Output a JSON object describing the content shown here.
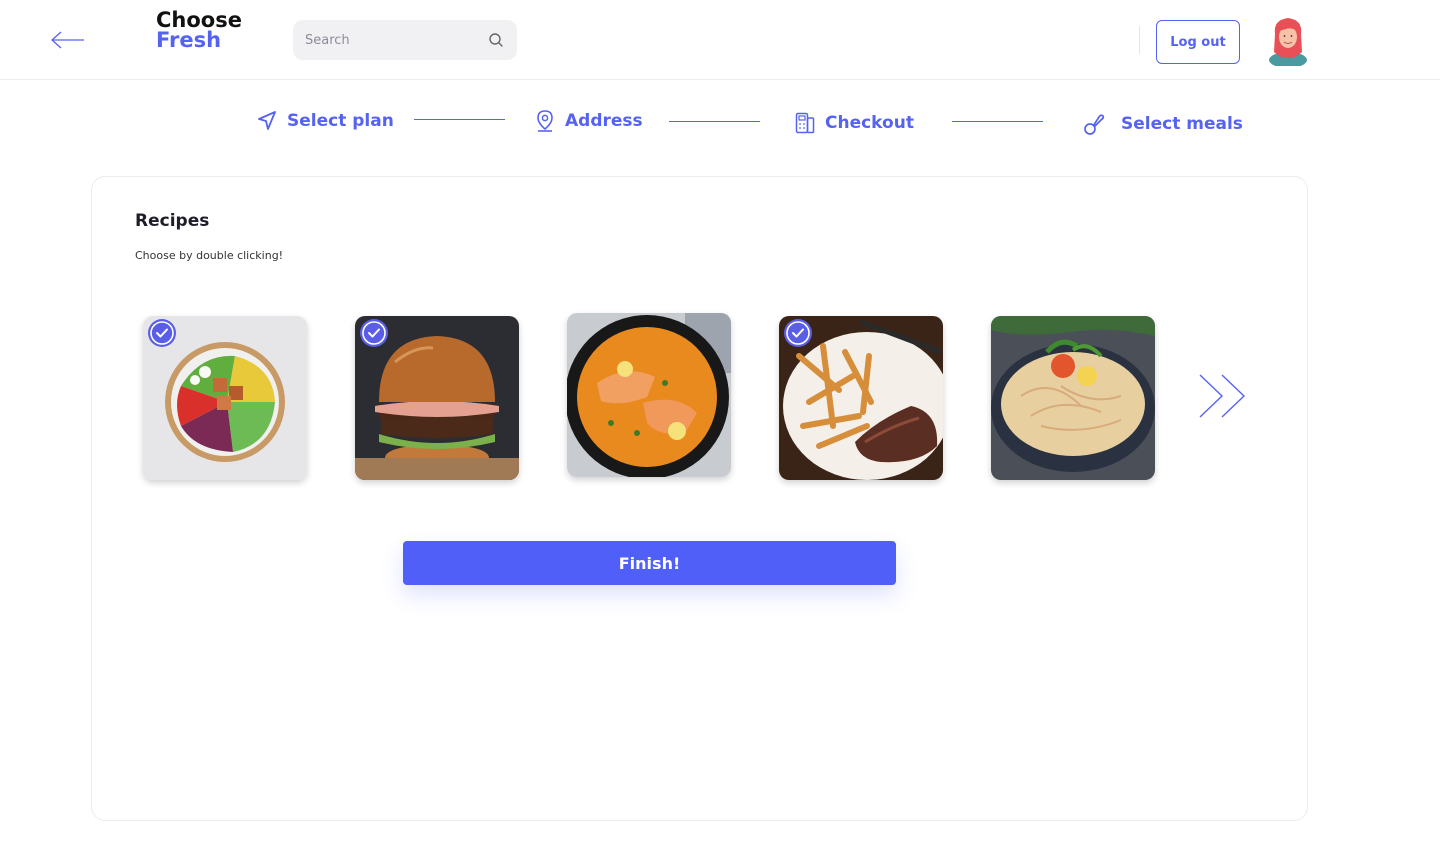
{
  "header": {
    "logo_line1": "Choose",
    "logo_line2": "Fresh",
    "search_placeholder": "Search",
    "logout_label": "Log out"
  },
  "stepper": [
    {
      "label": "Select plan",
      "icon": "navigation-arrow-icon"
    },
    {
      "label": "Address",
      "icon": "map-pin-icon"
    },
    {
      "label": "Checkout",
      "icon": "calculator-icon"
    },
    {
      "label": "Select meals",
      "icon": "meal-icon"
    }
  ],
  "recipes_section": {
    "title": "Recipes",
    "subtitle": "Choose by double clicking!",
    "items": [
      {
        "name": "salad bowl",
        "selected": true
      },
      {
        "name": "burger",
        "selected": true
      },
      {
        "name": "salmon curry",
        "selected": false
      },
      {
        "name": "steak and fries",
        "selected": true
      },
      {
        "name": "noodle soup",
        "selected": false
      }
    ],
    "finish_label": "Finish!"
  },
  "colors": {
    "accent": "#5663f0",
    "button": "#4f5ff7",
    "check": "#5a5ee6"
  }
}
